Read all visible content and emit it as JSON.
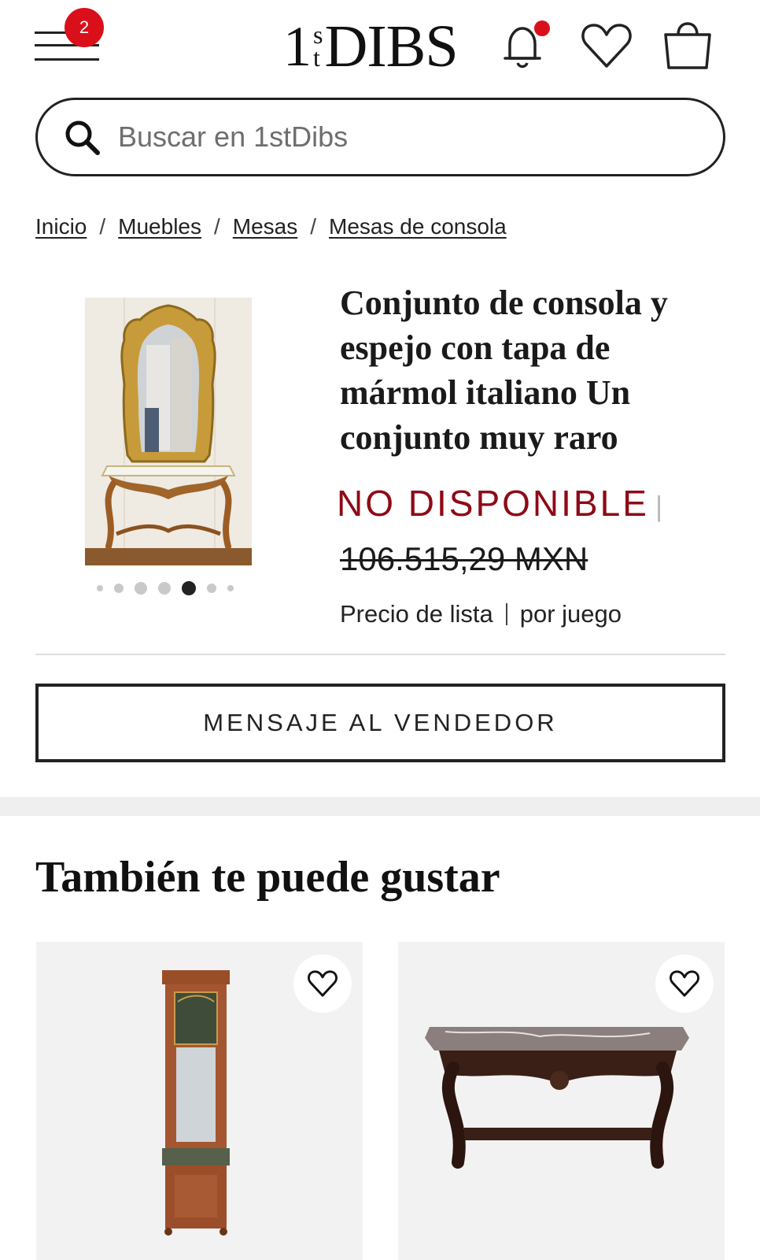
{
  "header": {
    "menu_badge": "2",
    "logo": {
      "one": "1",
      "s": "s",
      "t": "t",
      "word": "DIBS"
    },
    "icons": [
      "menu-icon",
      "bell-icon",
      "heart-icon",
      "bag-icon"
    ],
    "notification_dot_color": "#d9101a"
  },
  "search": {
    "placeholder": "Buscar en 1stDibs"
  },
  "breadcrumb": {
    "items": [
      "Inicio",
      "Muebles",
      "Mesas",
      "Mesas de consola"
    ],
    "separator": "/"
  },
  "product": {
    "title": "Conjunto de consola y espejo con tapa de mármol italiano Un conjunto muy raro",
    "status": "NO DISPONIBLE",
    "status_color": "#8e0a16",
    "price": "106.515,29 MXN",
    "price_label": "Precio de lista",
    "unit": "por juego",
    "carousel": {
      "total": 7,
      "active_index": 4
    }
  },
  "message_button": {
    "label": "MENSAJE AL VENDEDOR"
  },
  "recommendations": {
    "title": "También te puede gustar",
    "cards": [
      {
        "image": "hall-stand-mirror-image",
        "favorite_icon": "heart-icon"
      },
      {
        "image": "marble-console-table-image",
        "favorite_icon": "heart-icon"
      }
    ]
  }
}
